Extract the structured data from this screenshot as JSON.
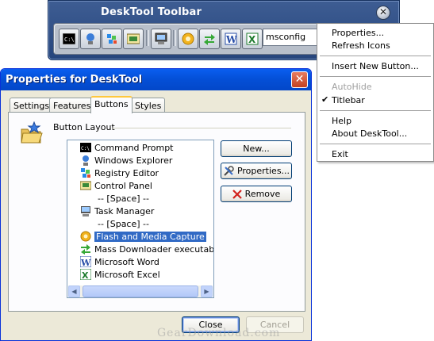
{
  "toolbar": {
    "title": "DeskTool Toolbar",
    "input_value": "msconfig",
    "buttons": [
      "command-prompt",
      "windows-explorer",
      "registry-editor",
      "control-panel",
      "task-manager",
      "flash-media-capture",
      "mass-downloader",
      "microsoft-word",
      "microsoft-excel"
    ]
  },
  "context_menu": {
    "items": {
      "properties": "Properties...",
      "refresh_icons": "Refresh Icons",
      "insert_new_button": "Insert New Button...",
      "autohide": "AutoHide",
      "titlebar": "Titlebar",
      "help": "Help",
      "about": "About DeskTool...",
      "exit": "Exit"
    },
    "titlebar_checked": true,
    "autohide_disabled": true
  },
  "dialog": {
    "title": "Properties for DeskTool",
    "tabs": [
      "Settings",
      "Features",
      "Buttons",
      "Styles"
    ],
    "active_tab": "Buttons",
    "group_label": "Button Layout",
    "list_items": [
      "Command Prompt",
      "Windows Explorer",
      "Registry Editor",
      "Control Panel",
      "-- [Space] --",
      "Task Manager",
      "-- [Space] --",
      "Flash and Media Capture",
      "Mass Downloader executable",
      "Microsoft Word",
      "Microsoft Excel"
    ],
    "selected_item": "Flash and Media Capture",
    "buttons": {
      "new": "New...",
      "properties": "Properties...",
      "remove": "Remove",
      "close": "Close",
      "cancel": "Cancel"
    }
  },
  "watermark": "GearDownload.com",
  "colors": {
    "xp_title_blue": "#0450d8",
    "selection_blue": "#316ac5",
    "dialog_bg": "#ece9d8",
    "toolbar_blue": "#26457c"
  }
}
